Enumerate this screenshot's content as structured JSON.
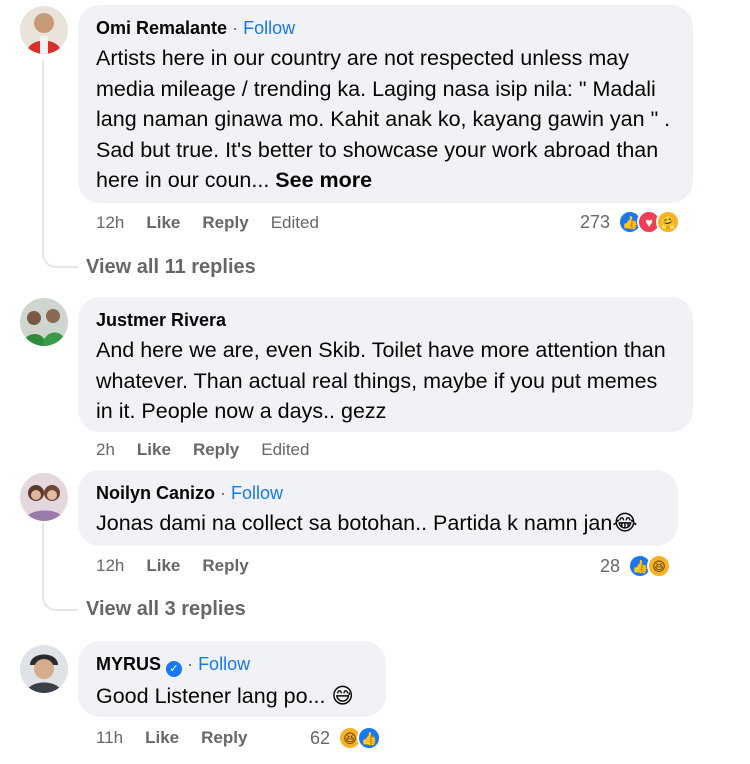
{
  "comments": [
    {
      "author": "Omi Remalante",
      "follow_label": "Follow",
      "separator": "·",
      "text": "Artists here in our country are not respected unless may media mileage / trending ka. Laging nasa isip nila: \" Madali lang naman ginawa mo. Kahit anak ko, kayang gawin yan \" . Sad but true. It's better to showcase your work abroad than here in our coun...",
      "see_more": "See more",
      "time": "12h",
      "like_label": "Like",
      "reply_label": "Reply",
      "edited_label": "Edited",
      "reaction_count": "273",
      "reactions": [
        "like-icon",
        "love-icon",
        "care-icon"
      ],
      "view_replies": "View all 11 replies"
    },
    {
      "author": "Justmer Rivera",
      "text": "And here we are, even Skib. Toilet have more attention than whatever. Than actual real things, maybe if you put memes in it. People now a days.. gezz",
      "time": "2h",
      "like_label": "Like",
      "reply_label": "Reply",
      "edited_label": "Edited"
    },
    {
      "author": "Noilyn Canizo",
      "follow_label": "Follow",
      "separator": "·",
      "text": "Jonas dami na collect sa botohan.. Partida k namn jan",
      "emoji": "😂",
      "time": "12h",
      "like_label": "Like",
      "reply_label": "Reply",
      "reaction_count": "28",
      "reactions": [
        "like-icon",
        "haha-icon"
      ],
      "view_replies": "View all 3 replies"
    },
    {
      "author": "MYRUS",
      "follow_label": "Follow",
      "separator": "·",
      "verified": "✓",
      "text": "Good Listener lang po...",
      "emoji": "😅",
      "time": "11h",
      "like_label": "Like",
      "reply_label": "Reply",
      "reaction_count": "62",
      "reactions": [
        "haha-icon",
        "like-icon"
      ]
    }
  ],
  "colors": {
    "bubble": "#f0f2f5",
    "link": "#1877f2",
    "meta": "#65676b",
    "like": "#1877f2",
    "love": "#f33e58",
    "haha": "#f7b125"
  }
}
